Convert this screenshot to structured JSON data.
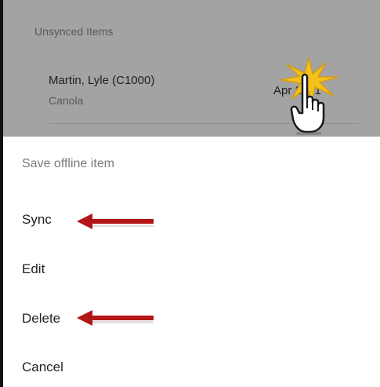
{
  "sync_list": {
    "section_label": "Unsynced Items",
    "item": {
      "name": "Martin, Lyle (C1000)",
      "crop": "Canola",
      "date": "Apr 2021"
    }
  },
  "context_menu": {
    "title": "Save offline item",
    "items": [
      {
        "label": "Sync"
      },
      {
        "label": "Edit"
      },
      {
        "label": "Delete"
      },
      {
        "label": "Cancel"
      }
    ]
  },
  "icons": {
    "click_burst": "click-burst-icon",
    "pointer": "hand-pointer-icon",
    "arrow": "left-arrow-icon"
  },
  "colors": {
    "header_bg": "#a3a3a3",
    "arrow": "#b31616",
    "burst": "#f2c21b"
  }
}
